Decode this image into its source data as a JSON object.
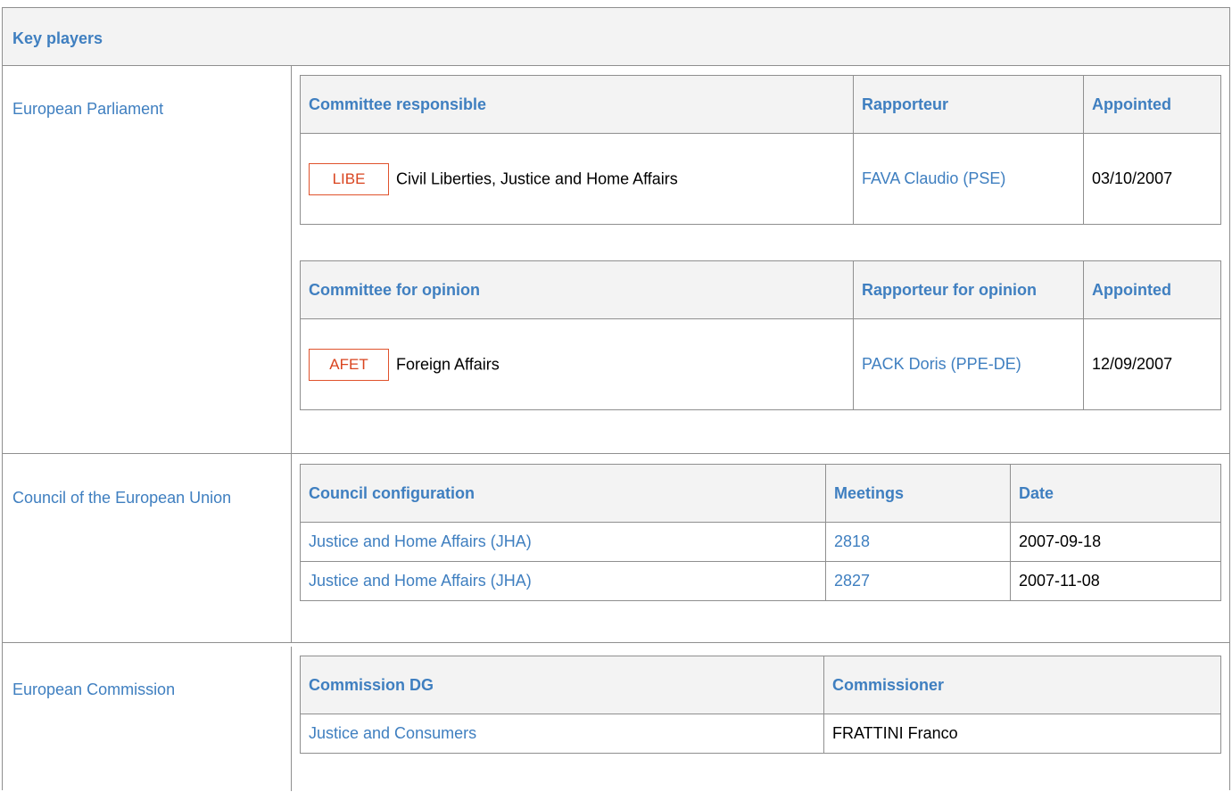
{
  "title": "Key players",
  "parliament": {
    "label": "European Parliament",
    "responsible": {
      "headers": [
        "Committee responsible",
        "Rapporteur",
        "Appointed"
      ],
      "rows": [
        {
          "code": "LIBE",
          "committee": "Civil Liberties, Justice and Home Affairs",
          "rapporteur": "FAVA Claudio (PSE)",
          "appointed": "03/10/2007"
        }
      ]
    },
    "opinion": {
      "headers": [
        "Committee for opinion",
        "Rapporteur for opinion",
        "Appointed"
      ],
      "rows": [
        {
          "code": "AFET",
          "committee": "Foreign Affairs",
          "rapporteur": "PACK Doris (PPE-DE)",
          "appointed": "12/09/2007"
        }
      ]
    }
  },
  "council": {
    "label": "Council of the European Union",
    "headers": [
      "Council configuration",
      "Meetings",
      "Date"
    ],
    "rows": [
      {
        "configuration": "Justice and Home Affairs (JHA)",
        "meeting": "2818",
        "date": "2007-09-18"
      },
      {
        "configuration": "Justice and Home Affairs (JHA)",
        "meeting": "2827",
        "date": "2007-11-08"
      }
    ]
  },
  "commission": {
    "label": "European Commission",
    "headers": [
      "Commission DG",
      "Commissioner"
    ],
    "rows": [
      {
        "dg": "Justice and Consumers",
        "commissioner": "FRATTINI Franco"
      }
    ]
  },
  "colors": {
    "link": "#3f7fc0",
    "badge_border": "#e0522c",
    "border": "#8f8f8f",
    "header_bg": "#f3f3f3"
  }
}
